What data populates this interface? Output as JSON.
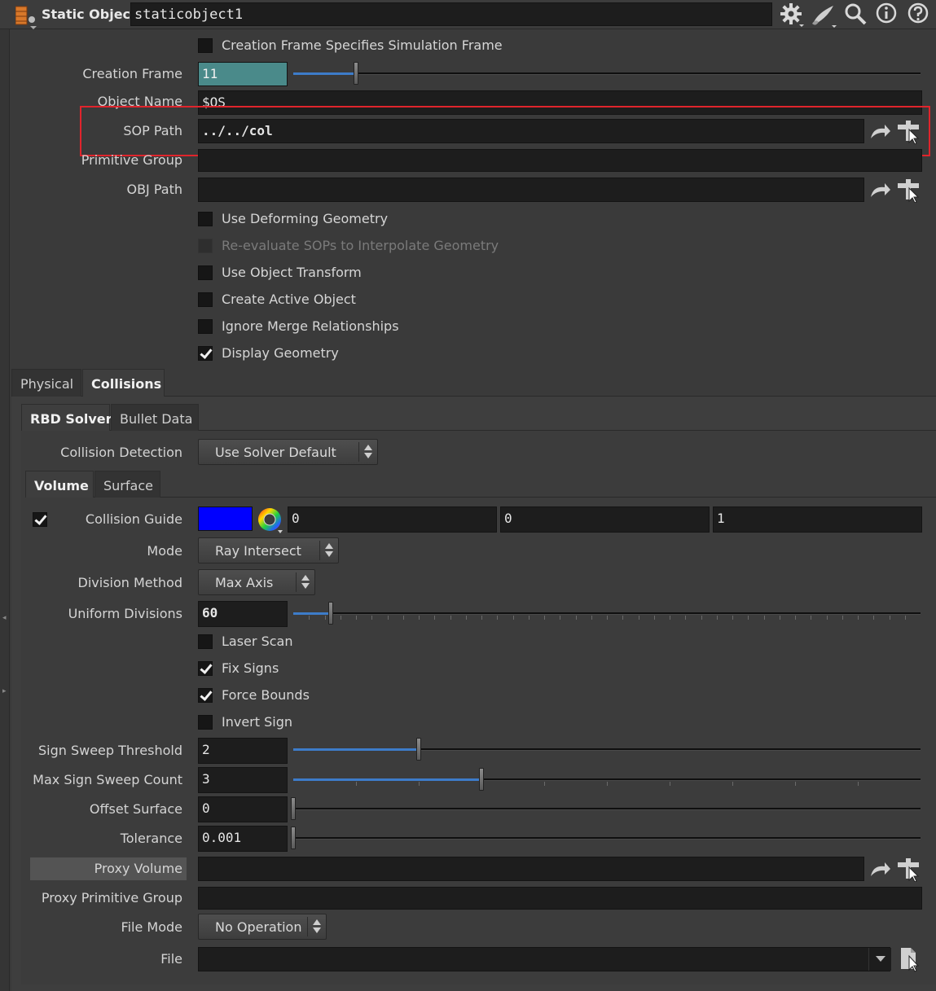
{
  "header": {
    "node_type": "Static Object",
    "node_name": "staticobject1",
    "icons": [
      "gear-icon",
      "paint-brush-icon",
      "search-icon",
      "info-icon",
      "help-icon"
    ]
  },
  "params": {
    "creation_frame_specifies": "Creation Frame Specifies Simulation Frame",
    "creation_frame_label": "Creation Frame",
    "creation_frame_value": "11",
    "object_name_label": "Object Name",
    "object_name_value": "$OS",
    "sop_path_label": "SOP Path",
    "sop_path_value": "../../col",
    "primitive_group_label": "Primitive Group",
    "primitive_group_value": "",
    "obj_path_label": "OBJ Path",
    "obj_path_value": "",
    "use_deforming": "Use Deforming Geometry",
    "reevaluate_sops": "Re-evaluate SOPs to Interpolate Geometry",
    "use_object_transform": "Use Object Transform",
    "create_active": "Create Active Object",
    "ignore_merge": "Ignore Merge Relationships",
    "display_geometry": "Display Geometry"
  },
  "tabs_main": [
    "Physical",
    "Collisions"
  ],
  "tabs_solver": [
    "RBD Solver",
    "Bullet Data"
  ],
  "collisions": {
    "collision_detection_label": "Collision Detection",
    "collision_detection_value": "Use Solver Default",
    "tabs_vol": [
      "Volume",
      "Surface"
    ],
    "collision_guide_label": "Collision Guide",
    "guide_color": "#0000ff",
    "guide_x": "0",
    "guide_y": "0",
    "guide_z": "1",
    "mode_label": "Mode",
    "mode_value": "Ray Intersect",
    "division_method_label": "Division Method",
    "division_method_value": "Max Axis",
    "uniform_divisions_label": "Uniform Divisions",
    "uniform_divisions_value": "60",
    "laser_scan": "Laser Scan",
    "fix_signs": "Fix Signs",
    "force_bounds": "Force Bounds",
    "invert_sign": "Invert Sign",
    "sign_sweep_label": "Sign Sweep Threshold",
    "sign_sweep_value": "2",
    "max_sign_label": "Max Sign Sweep Count",
    "max_sign_value": "3",
    "offset_surface_label": "Offset Surface",
    "offset_surface_value": "0",
    "tolerance_label": "Tolerance",
    "tolerance_value": "0.001",
    "proxy_volume_label": "Proxy Volume",
    "proxy_volume_value": "",
    "proxy_prim_group_label": "Proxy Primitive Group",
    "proxy_prim_group_value": "",
    "file_mode_label": "File Mode",
    "file_mode_value": "No Operation",
    "file_label": "File",
    "file_value": ""
  },
  "sliders": {
    "creation_frame_fraction": 0.1,
    "uniform_divisions_fraction": 0.06,
    "sign_sweep_fraction": 0.2,
    "max_sign_fraction": 0.3,
    "offset_surface_fraction": 0.0,
    "tolerance_fraction": 0.0
  },
  "highlight_color": "#e0242c"
}
